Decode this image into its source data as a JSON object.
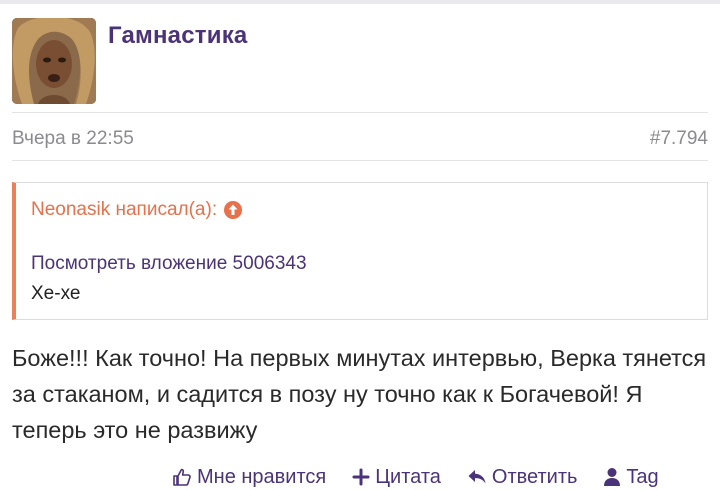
{
  "post": {
    "username": "Гамнастика",
    "date": "Вчера в 22:55",
    "number": "#7.794",
    "quote": {
      "author_line": "Neonasik написал(а):",
      "attachment_link": "Посмотреть вложение 5006343",
      "text": "Хе-хе"
    },
    "message": "Боже!!! Как точно! На первых минутах интервью, Верка тянется за стаканом, и садится в позу ну точно как к Богачевой! Я теперь это не развижу"
  },
  "actions": {
    "like": "Мне нравится",
    "quote": "Цитата",
    "reply": "Ответить",
    "tag": "Tag"
  },
  "icons": {
    "like": "thumbs-up-icon",
    "quote": "plus-icon",
    "reply": "reply-arrow-icon",
    "tag": "user-icon",
    "quote_jump": "arrow-up-circle-icon"
  },
  "colors": {
    "accent": "#4b3379",
    "quote_accent": "#e8704a",
    "muted": "#8b8b8f"
  }
}
